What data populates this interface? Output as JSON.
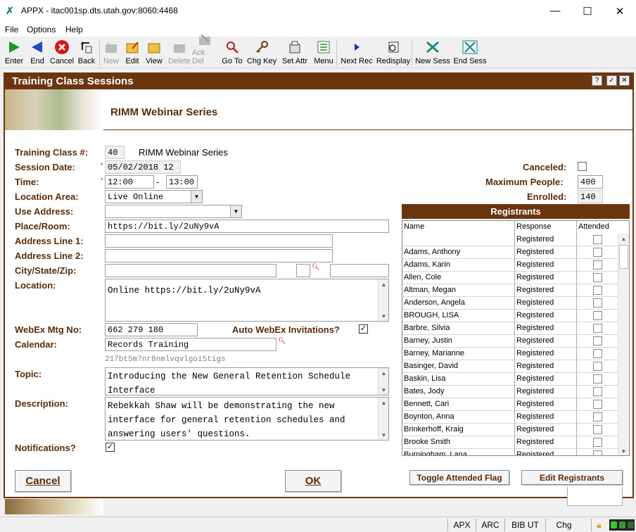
{
  "window": {
    "title": "APPX - itac001sp.dts.utah.gov:8060:4468",
    "minimize": "—",
    "maximize": "☐",
    "close": "✕"
  },
  "menu": [
    "File",
    "Options",
    "Help"
  ],
  "toolbar": [
    {
      "label": "Enter",
      "icon": "enter-icon",
      "enabled": true
    },
    {
      "label": "End",
      "icon": "end-icon",
      "enabled": true
    },
    {
      "label": "Cancel",
      "icon": "cancel-icon",
      "enabled": true
    },
    {
      "label": "Back",
      "icon": "back-icon",
      "enabled": true
    },
    {
      "label": "New",
      "icon": "new-icon",
      "enabled": false
    },
    {
      "label": "Edit",
      "icon": "edit-icon",
      "enabled": true
    },
    {
      "label": "View",
      "icon": "view-icon",
      "enabled": true
    },
    {
      "label": "Delete",
      "icon": "delete-icon",
      "enabled": false
    },
    {
      "label": "Ack Del",
      "icon": "ack-del-icon",
      "enabled": false
    },
    {
      "label": "Go To",
      "icon": "goto-icon",
      "enabled": true
    },
    {
      "label": "Chg Key",
      "icon": "key-icon",
      "enabled": true
    },
    {
      "label": "Set Attr",
      "icon": "set-attr-icon",
      "enabled": true
    },
    {
      "label": "Menu",
      "icon": "menu-icon",
      "enabled": true
    },
    {
      "label": "Next Rec",
      "icon": "next-rec-icon",
      "enabled": true
    },
    {
      "label": "Redisplay",
      "icon": "redisplay-icon",
      "enabled": true
    },
    {
      "label": "New Sess",
      "icon": "new-sess-icon",
      "enabled": true
    },
    {
      "label": "End Sess",
      "icon": "end-sess-icon",
      "enabled": true
    }
  ],
  "form": {
    "title": "Training Class Sessions",
    "title_buttons": [
      "?",
      "✓",
      "✕"
    ],
    "banner_title": "RIMM Webinar Series",
    "labels": {
      "class_no": "Training Class #:",
      "session_date": "Session Date:",
      "time": "Time:",
      "location_area": "Location Area:",
      "use_address": "Use Address:",
      "place_room": "Place/Room:",
      "address1": "Address Line 1:",
      "address2": "Address Line 2:",
      "city_state_zip": "City/State/Zip:",
      "location": "Location:",
      "webex": "WebEx Mtg No:",
      "auto_webex": "Auto WebEx Invitations?",
      "calendar": "Calendar:",
      "topic": "Topic:",
      "description": "Description:",
      "notifications": "Notifications?",
      "canceled": "Canceled:",
      "max_people": "Maximum People:",
      "enrolled": "Enrolled:"
    },
    "values": {
      "class_no": "40",
      "class_name": "RIMM Webinar Series",
      "session_date": "05/02/2018 12",
      "time_from": "12:00",
      "time_dash": "-",
      "time_to": "13:00",
      "location_area": "Live Online",
      "use_address": "",
      "place_room": "https://bit.ly/2uNy9vA",
      "address1": "",
      "address2": "",
      "city": "",
      "state": "",
      "zip": "",
      "location": "Online https://bit.ly/2uNy9vA",
      "webex": "662 279 180",
      "auto_webex": true,
      "calendar": "Records Training",
      "calendar_id": "217bt5m7nr8nmlvqvlgoi5tigs",
      "topic": "Introducing the New General Retention Schedule Interface",
      "description": "Rebekkah Shaw will be demonstrating the new interface for general retention schedules and answering users' questions.",
      "notifications": true,
      "canceled": false,
      "max_people": "400",
      "enrolled": "140"
    }
  },
  "registrants": {
    "title": "Registrants",
    "columns": [
      "Name",
      "Response",
      "Attended"
    ],
    "rows": [
      {
        "name": "",
        "response": "Registered",
        "attended": false
      },
      {
        "name": "Adams, Anthony",
        "response": "Registered",
        "attended": false
      },
      {
        "name": "Adams, Karin",
        "response": "Registered",
        "attended": false
      },
      {
        "name": "Allen, Cole",
        "response": "Registered",
        "attended": false
      },
      {
        "name": "Altman, Megan",
        "response": "Registered",
        "attended": false
      },
      {
        "name": "Anderson, Angela",
        "response": "Registered",
        "attended": false
      },
      {
        "name": "BROUGH, LISA",
        "response": "Registered",
        "attended": false
      },
      {
        "name": "Barbre, Silvia",
        "response": "Registered",
        "attended": false
      },
      {
        "name": "Barney, Justin",
        "response": "Registered",
        "attended": false
      },
      {
        "name": "Barney, Marianne",
        "response": "Registered",
        "attended": false
      },
      {
        "name": "Basinger, David",
        "response": "Registered",
        "attended": false
      },
      {
        "name": "Baskin, Lisa",
        "response": "Registered",
        "attended": false
      },
      {
        "name": "Bates, Jody",
        "response": "Registered",
        "attended": false
      },
      {
        "name": "Bennett, Cari",
        "response": "Registered",
        "attended": false
      },
      {
        "name": "Boynton, Anna",
        "response": "Registered",
        "attended": false
      },
      {
        "name": "Brinkerhoff, Kraig",
        "response": "Registered",
        "attended": false
      },
      {
        "name": "Brooke Smith",
        "response": "Registered",
        "attended": false
      },
      {
        "name": "Burningham, Lana",
        "response": "Registered",
        "attended": false
      }
    ]
  },
  "buttons": {
    "cancel": "Cancel",
    "ok": "OK",
    "toggle_attended": "Toggle Attended Flag",
    "edit_registrants": "Edit Registrants"
  },
  "status": [
    "APX",
    "ARC",
    "BIB UT",
    "Chg"
  ]
}
